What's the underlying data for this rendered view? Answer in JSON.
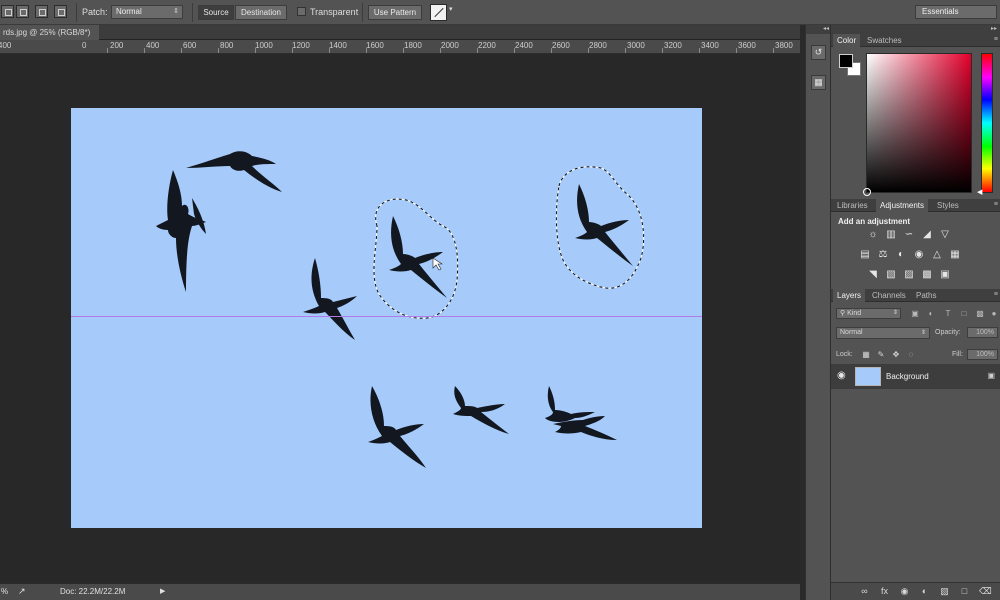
{
  "options_bar": {
    "patch_label": "Patch:",
    "patch_mode": "Normal",
    "source_label": "Source",
    "destination_label": "Destination",
    "transparent_label": "Transparent",
    "use_pattern_label": "Use Pattern",
    "workspace": "Essentials"
  },
  "document": {
    "tab_title": "rds.jpg @ 25% (RGB/8*)",
    "ruler_labels": [
      "400",
      "0",
      "200",
      "400",
      "600",
      "800",
      "1000",
      "1200",
      "1400",
      "1600",
      "1800",
      "2000",
      "2200",
      "2400",
      "2600",
      "2800",
      "3000",
      "3200",
      "3400",
      "3600",
      "3800"
    ]
  },
  "status_bar": {
    "zoom": "%",
    "doc_size": "Doc: 22.2M/22.2M"
  },
  "color_panel": {
    "tabs": [
      "Color",
      "Swatches"
    ],
    "foreground": "#000000",
    "background": "#ffffff"
  },
  "adjustments_panel": {
    "tabs": [
      "Libraries",
      "Adjustments",
      "Styles"
    ],
    "title": "Add an adjustment"
  },
  "layers_panel": {
    "tabs": [
      "Layers",
      "Channels",
      "Paths"
    ],
    "filter_kind": "Kind",
    "blend_mode": "Normal",
    "opacity_label": "Opacity:",
    "opacity_value": "100%",
    "lock_label": "Lock:",
    "fill_label": "Fill:",
    "fill_value": "100%",
    "layers": [
      {
        "name": "Background",
        "visible": true,
        "locked": true
      }
    ]
  },
  "colors": {
    "sky": "#a6cbfa",
    "guide": "#b07be6",
    "ui_panel": "#535353",
    "ui_dark": "#282828"
  }
}
